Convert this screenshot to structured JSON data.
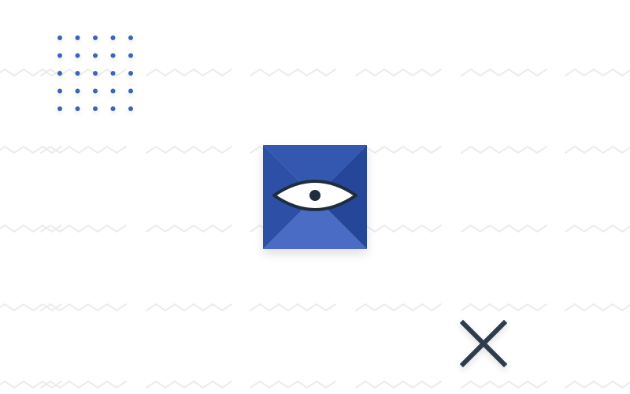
{
  "colors": {
    "background": "#ffffff",
    "zigzag": "#ececec",
    "dots": "#3d63b8",
    "logo_dark": "#26469a",
    "logo_mid": "#3458b0",
    "logo_light": "#4a6cc4",
    "eye_white": "#ffffff",
    "eye_outline": "#1f2d3d",
    "close_icon": "#2e3d4d"
  },
  "icons": {
    "logo": "eye-pyramid-logo-icon",
    "dots": "dot-grid-icon",
    "close": "close-x-icon"
  },
  "dot_grid": {
    "rows": 5,
    "cols": 5
  }
}
